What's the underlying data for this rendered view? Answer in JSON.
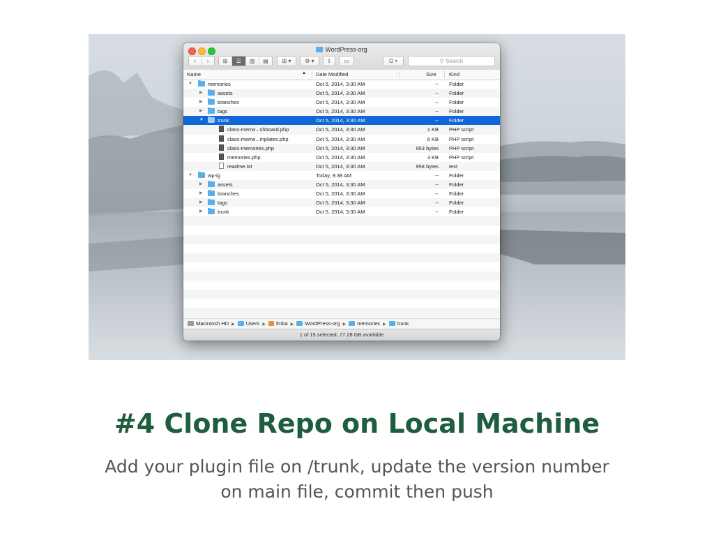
{
  "window": {
    "title": "WordPress-org",
    "search_placeholder": "Search",
    "toolbar": {
      "back": "‹",
      "forward": "›",
      "view_icons": "⊞",
      "view_list": "☰",
      "view_columns": "▥",
      "view_coverflow": "▤",
      "arrange": "⊞ ▾",
      "action": "⚙ ▾",
      "share": "⇪",
      "tags": "▭",
      "dropbox": "⛋ ▾"
    },
    "columns": {
      "name": "Name",
      "date": "Date Modified",
      "size": "Size",
      "kind": "Kind"
    },
    "rows": [
      {
        "name": "memories",
        "date": "Oct 5, 2014, 3:30 AM",
        "size": "--",
        "kind": "Folder"
      },
      {
        "name": "assets",
        "date": "Oct 5, 2014, 3:30 AM",
        "size": "--",
        "kind": "Folder"
      },
      {
        "name": "branches",
        "date": "Oct 5, 2014, 3:30 AM",
        "size": "--",
        "kind": "Folder"
      },
      {
        "name": "tags",
        "date": "Oct 5, 2014, 3:30 AM",
        "size": "--",
        "kind": "Folder"
      },
      {
        "name": "trunk",
        "date": "Oct 5, 2014, 3:30 AM",
        "size": "--",
        "kind": "Folder"
      },
      {
        "name": "class-memo...shboard.php",
        "date": "Oct 5, 2014, 3:30 AM",
        "size": "1 KB",
        "kind": "PHP script"
      },
      {
        "name": "class-memo...mplates.php",
        "date": "Oct 5, 2014, 3:30 AM",
        "size": "6 KB",
        "kind": "PHP script"
      },
      {
        "name": "class-memories.php",
        "date": "Oct 5, 2014, 3:30 AM",
        "size": "953 bytes",
        "kind": "PHP script"
      },
      {
        "name": "memories.php",
        "date": "Oct 5, 2014, 3:30 AM",
        "size": "3 KB",
        "kind": "PHP script"
      },
      {
        "name": "readme.txt",
        "date": "Oct 5, 2014, 3:30 AM",
        "size": "958 bytes",
        "kind": "text"
      },
      {
        "name": "wp-ig",
        "date": "Today, 9:38 AM",
        "size": "--",
        "kind": "Folder"
      },
      {
        "name": "assets",
        "date": "Oct 5, 2014, 3:30 AM",
        "size": "--",
        "kind": "Folder"
      },
      {
        "name": "branches",
        "date": "Oct 5, 2014, 3:30 AM",
        "size": "--",
        "kind": "Folder"
      },
      {
        "name": "tags",
        "date": "Oct 5, 2014, 3:30 AM",
        "size": "--",
        "kind": "Folder"
      },
      {
        "name": "trunk",
        "date": "Oct 5, 2014, 3:30 AM",
        "size": "--",
        "kind": "Folder"
      }
    ],
    "path": [
      "Macintosh HD",
      "Users",
      "fmba",
      "WordPress-org",
      "memories",
      "trunk"
    ],
    "status": "1 of 15 selected, 77.28 GB available"
  },
  "slide": {
    "heading": "#4 Clone Repo on Local Machine",
    "subtitle_line1": "Add your plugin file on /trunk, update the version number",
    "subtitle_line2": "on main file, commit then push"
  },
  "colors": {
    "heading": "#1f5d3f",
    "selection": "#1167d8",
    "folder": "#5aaeea"
  }
}
